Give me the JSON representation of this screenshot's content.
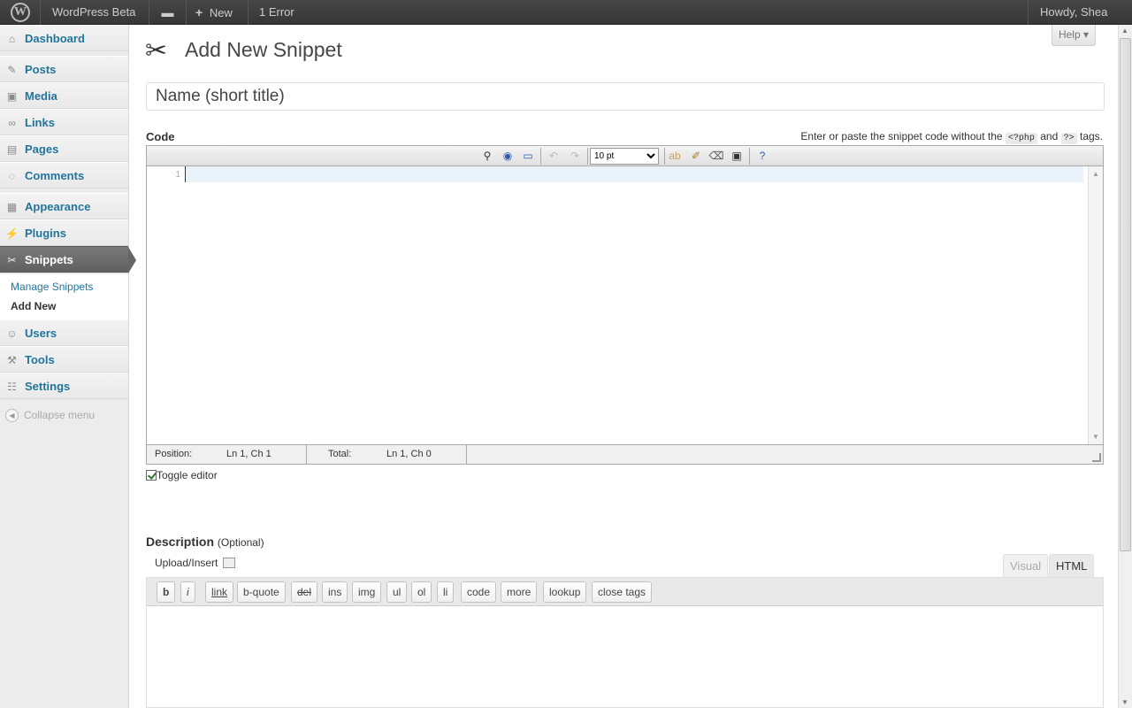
{
  "adminbar": {
    "site_name": "WordPress Beta",
    "new_label": "New",
    "error_label": "1 Error",
    "howdy": "Howdy, Shea"
  },
  "sidebar": {
    "items": [
      {
        "label": "Dashboard",
        "icon": "dashboard-icon"
      },
      {
        "label": "Posts",
        "icon": "pushpin-icon"
      },
      {
        "label": "Media",
        "icon": "media-icon"
      },
      {
        "label": "Links",
        "icon": "link-icon"
      },
      {
        "label": "Pages",
        "icon": "pages-icon"
      },
      {
        "label": "Comments",
        "icon": "comment-icon"
      },
      {
        "label": "Appearance",
        "icon": "appearance-icon"
      },
      {
        "label": "Plugins",
        "icon": "plug-icon"
      },
      {
        "label": "Snippets",
        "icon": "scissors-icon"
      },
      {
        "label": "Users",
        "icon": "users-icon"
      },
      {
        "label": "Tools",
        "icon": "tools-icon"
      },
      {
        "label": "Settings",
        "icon": "settings-icon"
      }
    ],
    "submenu": [
      "Manage Snippets",
      "Add New"
    ],
    "collapse_label": "Collapse menu"
  },
  "page": {
    "title": "Add New Snippet",
    "help_label": "Help ▾",
    "name_placeholder": "Name (short title)"
  },
  "code": {
    "label": "Code",
    "hint_prefix": "Enter or paste the snippet code without the",
    "hint_open_tag": "<?php",
    "hint_and": "and",
    "hint_close_tag": "?>",
    "hint_suffix": "tags.",
    "font_size": "10 pt",
    "line_number": "1",
    "status": {
      "position_label": "Position:",
      "position_value": "Ln 1, Ch 1",
      "total_label": "Total:",
      "total_value": "Ln 1, Ch 0"
    },
    "toggle_label": "Toggle editor"
  },
  "description": {
    "label": "Description",
    "optional": "(Optional)",
    "upload_label": "Upload/Insert",
    "tab_visual": "Visual",
    "tab_html": "HTML",
    "quicktags": [
      "b",
      "i",
      "link",
      "b-quote",
      "del",
      "ins",
      "img",
      "ul",
      "ol",
      "li",
      "code",
      "more",
      "lookup",
      "close tags"
    ]
  }
}
